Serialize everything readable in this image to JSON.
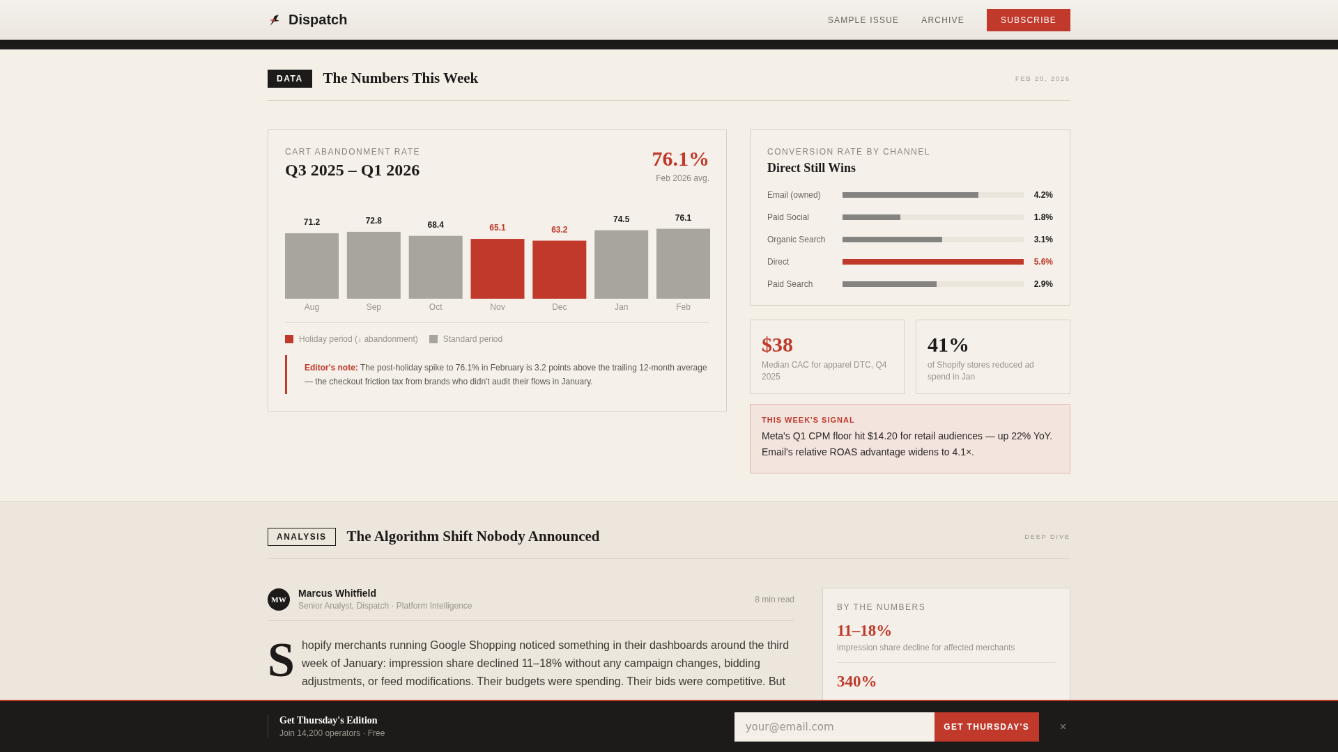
{
  "header": {
    "brand": "Dispatch",
    "nav": [
      "SAMPLE ISSUE",
      "ARCHIVE"
    ],
    "subscribe": "SUBSCRIBE"
  },
  "data_section": {
    "tag": "DATA",
    "title": "The Numbers This Week",
    "date": "FEB 20, 2026",
    "abandonment": {
      "label": "CART ABANDONMENT RATE",
      "title": "Q3 2025 – Q1 2026",
      "headline": "76.1%",
      "headline_caption": "Feb 2026 avg.",
      "chart_data": {
        "type": "bar",
        "categories": [
          "Aug",
          "Sep",
          "Oct",
          "Nov",
          "Dec",
          "Jan",
          "Feb"
        ],
        "stacked": true,
        "data_labels": true,
        "series": [
          {
            "name": "Holiday period (↓ abandonment)",
            "color": "#c0392b",
            "values": [
              null,
              null,
              null,
              65.1,
              63.2,
              null,
              null
            ]
          },
          {
            "name": "Standard period",
            "color": "#a8a49e",
            "values": [
              71.2,
              72.8,
              68.4,
              null,
              null,
              74.5,
              76.1
            ]
          }
        ]
      },
      "note_label": "Editor's note:",
      "note": "The post-holiday spike to 76.1% in February is 3.2 points above the trailing 12-month average — the checkout friction tax from brands who didn't audit their flows in January."
    },
    "conversion": {
      "label": "CONVERSION RATE BY CHANNEL",
      "title": "Direct Still Wins",
      "channels": [
        {
          "name": "Email (owned)",
          "level": 0.75,
          "reading": "4.2%",
          "highlighted": false
        },
        {
          "name": "Paid Social",
          "level": 0.32,
          "reading": "1.8%",
          "highlighted": false
        },
        {
          "name": "Organic Search",
          "level": 0.55,
          "reading": "3.1%",
          "highlighted": false
        },
        {
          "name": "Direct",
          "level": 1,
          "reading": "5.6%",
          "highlighted": true
        },
        {
          "name": "Paid Search",
          "level": 0.52,
          "reading": "2.9%",
          "highlighted": false
        }
      ]
    },
    "stats": [
      {
        "value": "$38",
        "caption": "Median CAC for apparel DTC, Q4 2025",
        "highlighted": true
      },
      {
        "value": "41%",
        "caption": "of Shopify stores reduced ad spend in Jan",
        "highlighted": false
      }
    ],
    "signal": {
      "title": "THIS WEEK'S SIGNAL",
      "text": "Meta's Q1 CPM floor hit $14.20 for retail audiences — up 22% YoY. Email's relative ROAS advantage widens to 4.1×."
    }
  },
  "analysis_section": {
    "tag": "ANALYSIS",
    "title": "The Algorithm Shift Nobody Announced",
    "kicker": "DEEP DIVE",
    "author": {
      "initials": "MW",
      "name": "Marcus Whitfield",
      "role": "Senior Analyst, Dispatch · Platform Intelligence",
      "read_time": "8 min read"
    },
    "drop_cap": "S",
    "body": "hopify merchants running Google Shopping noticed something in their dashboards around the third week of January: impression share declined 11–18% without any campaign changes, bidding adjustments, or feed modifications. Their budgets were spending. Their bids were competitive. But",
    "sidebar": {
      "title": "BY THE NUMBERS",
      "stats": [
        {
          "value": "11–18%",
          "caption": "impression share decline for affected merchants"
        },
        {
          "value": "340%"
        }
      ]
    }
  },
  "signup_bar": {
    "title": "Get Thursday's Edition",
    "subtitle": "Join 14,200 operators · Free",
    "placeholder": "your@email.com",
    "button": "GET THURSDAY'S",
    "close": "×"
  }
}
